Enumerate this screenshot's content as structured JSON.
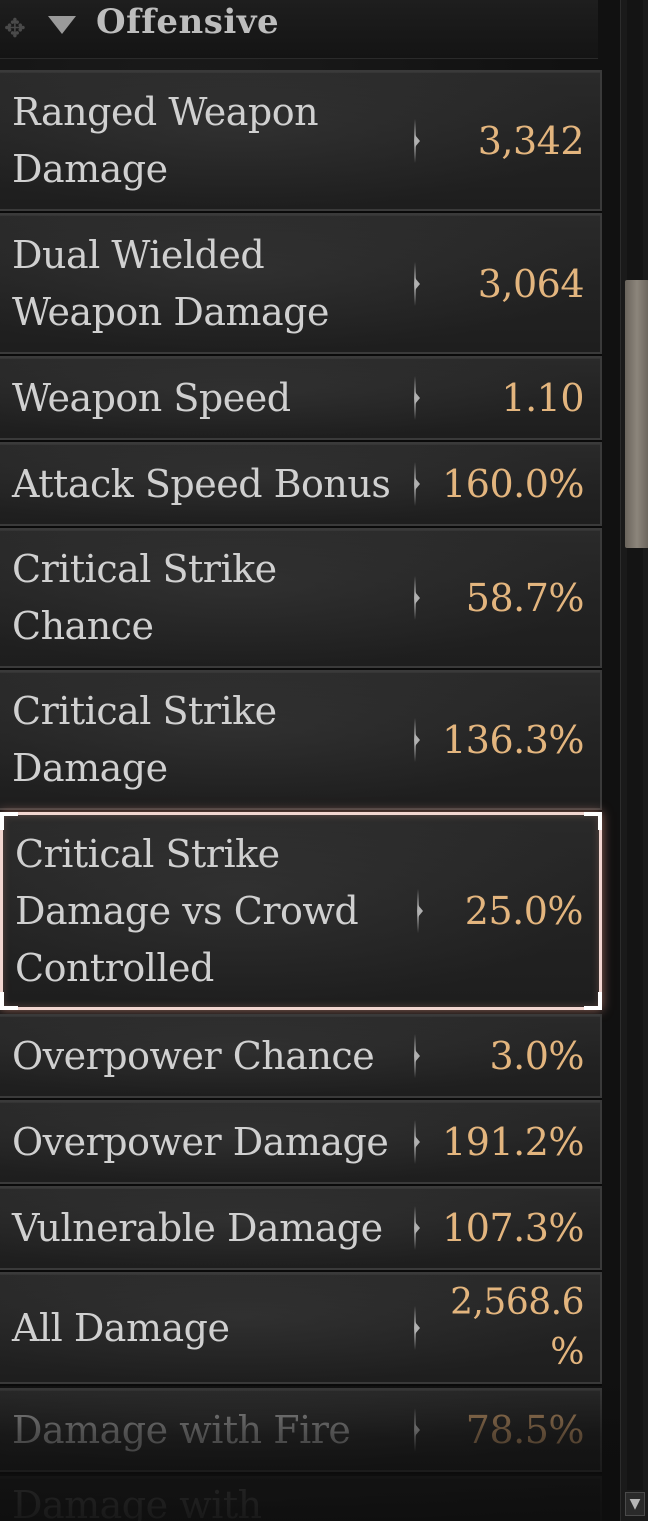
{
  "section": {
    "title": "Offensive"
  },
  "stats": [
    {
      "label": "Ranged Weapon Damage",
      "value": "3,342"
    },
    {
      "label": "Dual Wielded Weapon Damage",
      "value": "3,064"
    },
    {
      "label": "Weapon Speed",
      "value": "1.10"
    },
    {
      "label": "Attack Speed Bonus",
      "value": "160.0%"
    },
    {
      "label": "Critical Strike Chance",
      "value": "58.7%"
    },
    {
      "label": "Critical Strike Damage",
      "value": "136.3%"
    },
    {
      "label": "Critical Strike Damage vs Crowd Controlled",
      "value": "25.0%",
      "selected": true
    },
    {
      "label": "Overpower Chance",
      "value": "3.0%"
    },
    {
      "label": "Overpower Damage",
      "value": "191.2%"
    },
    {
      "label": "Vulnerable Damage",
      "value": "107.3%"
    },
    {
      "label": "All Damage",
      "value": "2,568.6 %"
    },
    {
      "label": "Damage with Fire",
      "value": "78.5%"
    },
    {
      "label": "Damage with",
      "value": ""
    }
  ],
  "scrollbar": {
    "down_icon": "▼"
  },
  "colors": {
    "value_text": "#e3b57e",
    "label_text": "#d0d0d0",
    "selected_border": "#f2d6d0"
  }
}
